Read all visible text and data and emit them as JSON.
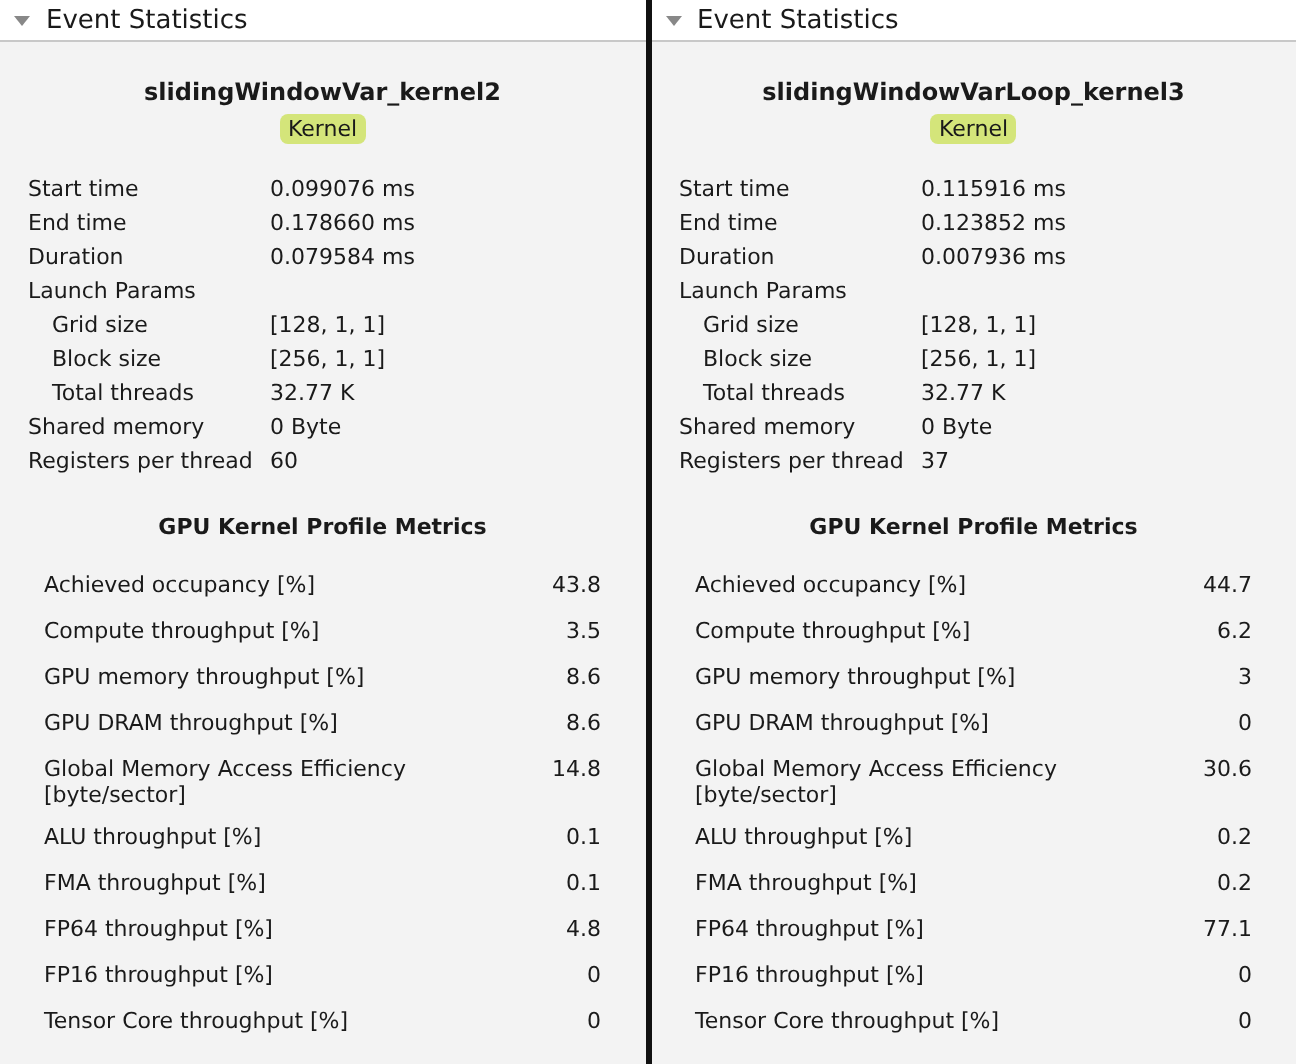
{
  "panels": [
    {
      "header": {
        "label": "Event Statistics",
        "expanded": true
      },
      "kernel_name": "slidingWindowVar_kernel2",
      "badge": "Kernel",
      "properties": [
        {
          "label": "Start time",
          "value": "0.099076 ms"
        },
        {
          "label": "End time",
          "value": "0.178660 ms"
        },
        {
          "label": "Duration",
          "value": "0.079584 ms"
        },
        {
          "label": "Launch Params",
          "children": [
            {
              "label": "Grid size",
              "value": "[128, 1, 1]"
            },
            {
              "label": "Block size",
              "value": "[256, 1, 1]"
            },
            {
              "label": "Total threads",
              "value": "32.77 K"
            }
          ]
        },
        {
          "label": "Shared memory",
          "value": "0 Byte"
        },
        {
          "label": "Registers per thread",
          "value": "60"
        }
      ],
      "metrics_title": "GPU Kernel Profile Metrics",
      "metrics": [
        {
          "label": "Achieved occupancy [%]",
          "value": "43.8"
        },
        {
          "label": "Compute throughput [%]",
          "value": "3.5"
        },
        {
          "label": "GPU memory throughput [%]",
          "value": "8.6"
        },
        {
          "label": "GPU DRAM throughput [%]",
          "value": "8.6"
        },
        {
          "label": "Global Memory Access Efficiency [byte/sector]",
          "value": "14.8"
        },
        {
          "label": "ALU throughput [%]",
          "value": "0.1"
        },
        {
          "label": "FMA throughput [%]",
          "value": "0.1"
        },
        {
          "label": "FP64 throughput [%]",
          "value": "4.8"
        },
        {
          "label": "FP16 throughput [%]",
          "value": "0"
        },
        {
          "label": "Tensor Core throughput [%]",
          "value": "0"
        }
      ]
    },
    {
      "header": {
        "label": "Event Statistics",
        "expanded": true
      },
      "kernel_name": "slidingWindowVarLoop_kernel3",
      "badge": "Kernel",
      "properties": [
        {
          "label": "Start time",
          "value": "0.115916 ms"
        },
        {
          "label": "End time",
          "value": "0.123852 ms"
        },
        {
          "label": "Duration",
          "value": "0.007936 ms"
        },
        {
          "label": "Launch Params",
          "children": [
            {
              "label": "Grid size",
              "value": "[128, 1, 1]"
            },
            {
              "label": "Block size",
              "value": "[256, 1, 1]"
            },
            {
              "label": "Total threads",
              "value": "32.77 K"
            }
          ]
        },
        {
          "label": "Shared memory",
          "value": "0 Byte"
        },
        {
          "label": "Registers per thread",
          "value": "37"
        }
      ],
      "metrics_title": "GPU Kernel Profile Metrics",
      "metrics": [
        {
          "label": "Achieved occupancy [%]",
          "value": "44.7"
        },
        {
          "label": "Compute throughput [%]",
          "value": "6.2"
        },
        {
          "label": "GPU memory throughput [%]",
          "value": "3"
        },
        {
          "label": "GPU DRAM throughput [%]",
          "value": "0"
        },
        {
          "label": "Global Memory Access Efficiency [byte/sector]",
          "value": "30.6"
        },
        {
          "label": "ALU throughput [%]",
          "value": "0.2"
        },
        {
          "label": "FMA throughput [%]",
          "value": "0.2"
        },
        {
          "label": "FP64 throughput [%]",
          "value": "77.1"
        },
        {
          "label": "FP16 throughput [%]",
          "value": "0"
        },
        {
          "label": "Tensor Core throughput [%]",
          "value": "0"
        }
      ]
    }
  ]
}
